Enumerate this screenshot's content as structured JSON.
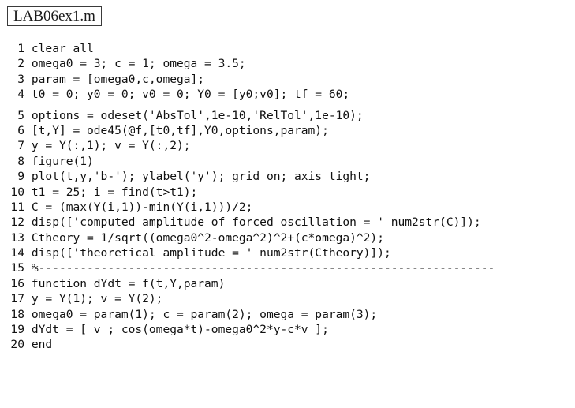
{
  "window": {
    "filename": "LAB06ex1.m",
    "language": "matlab",
    "background_color": "#ffffff",
    "text_color": "#111111",
    "border_color": "#3a3a3a"
  },
  "editor": {
    "first_line_number": 1,
    "last_line_number": 20,
    "total_lines": 20,
    "groups": [
      {
        "lines": [
          {
            "number": "1",
            "text": "clear all"
          },
          {
            "number": "2",
            "text": "omega0 = 3; c = 1; omega = 3.5;"
          },
          {
            "number": "3",
            "text": "param = [omega0,c,omega];"
          },
          {
            "number": "4",
            "text": "t0 = 0; y0 = 0; v0 = 0; Y0 = [y0;v0]; tf = 60;"
          }
        ]
      },
      {
        "lines": [
          {
            "number": "5",
            "text": "options = odeset('AbsTol',1e-10,'RelTol',1e-10);"
          },
          {
            "number": "6",
            "text": "[t,Y] = ode45(@f,[t0,tf],Y0,options,param);"
          },
          {
            "number": "7",
            "text": "y = Y(:,1); v = Y(:,2);"
          },
          {
            "number": "8",
            "text": "figure(1)"
          },
          {
            "number": "9",
            "text": "plot(t,y,'b-'); ylabel('y'); grid on; axis tight;"
          },
          {
            "number": "10",
            "text": "t1 = 25; i = find(t>t1);"
          },
          {
            "number": "11",
            "text": "C = (max(Y(i,1))-min(Y(i,1)))/2;"
          },
          {
            "number": "12",
            "text": "disp(['computed amplitude of forced oscillation = ' num2str(C)]);"
          },
          {
            "number": "13",
            "text": "Ctheory = 1/sqrt((omega0^2-omega^2)^2+(c*omega)^2);"
          },
          {
            "number": "14",
            "text": "disp(['theoretical amplitude = ' num2str(Ctheory)]);"
          },
          {
            "number": "15",
            "text": "%------------------------------------------------------------------"
          },
          {
            "number": "16",
            "text": "function dYdt = f(t,Y,param)"
          },
          {
            "number": "17",
            "text": "y = Y(1); v = Y(2);"
          },
          {
            "number": "18",
            "text": "omega0 = param(1); c = param(2); omega = param(3);"
          },
          {
            "number": "19",
            "text": "dYdt = [ v ; cos(omega*t)-omega0^2*y-c*v ];"
          },
          {
            "number": "20",
            "text": "end"
          }
        ]
      }
    ]
  }
}
